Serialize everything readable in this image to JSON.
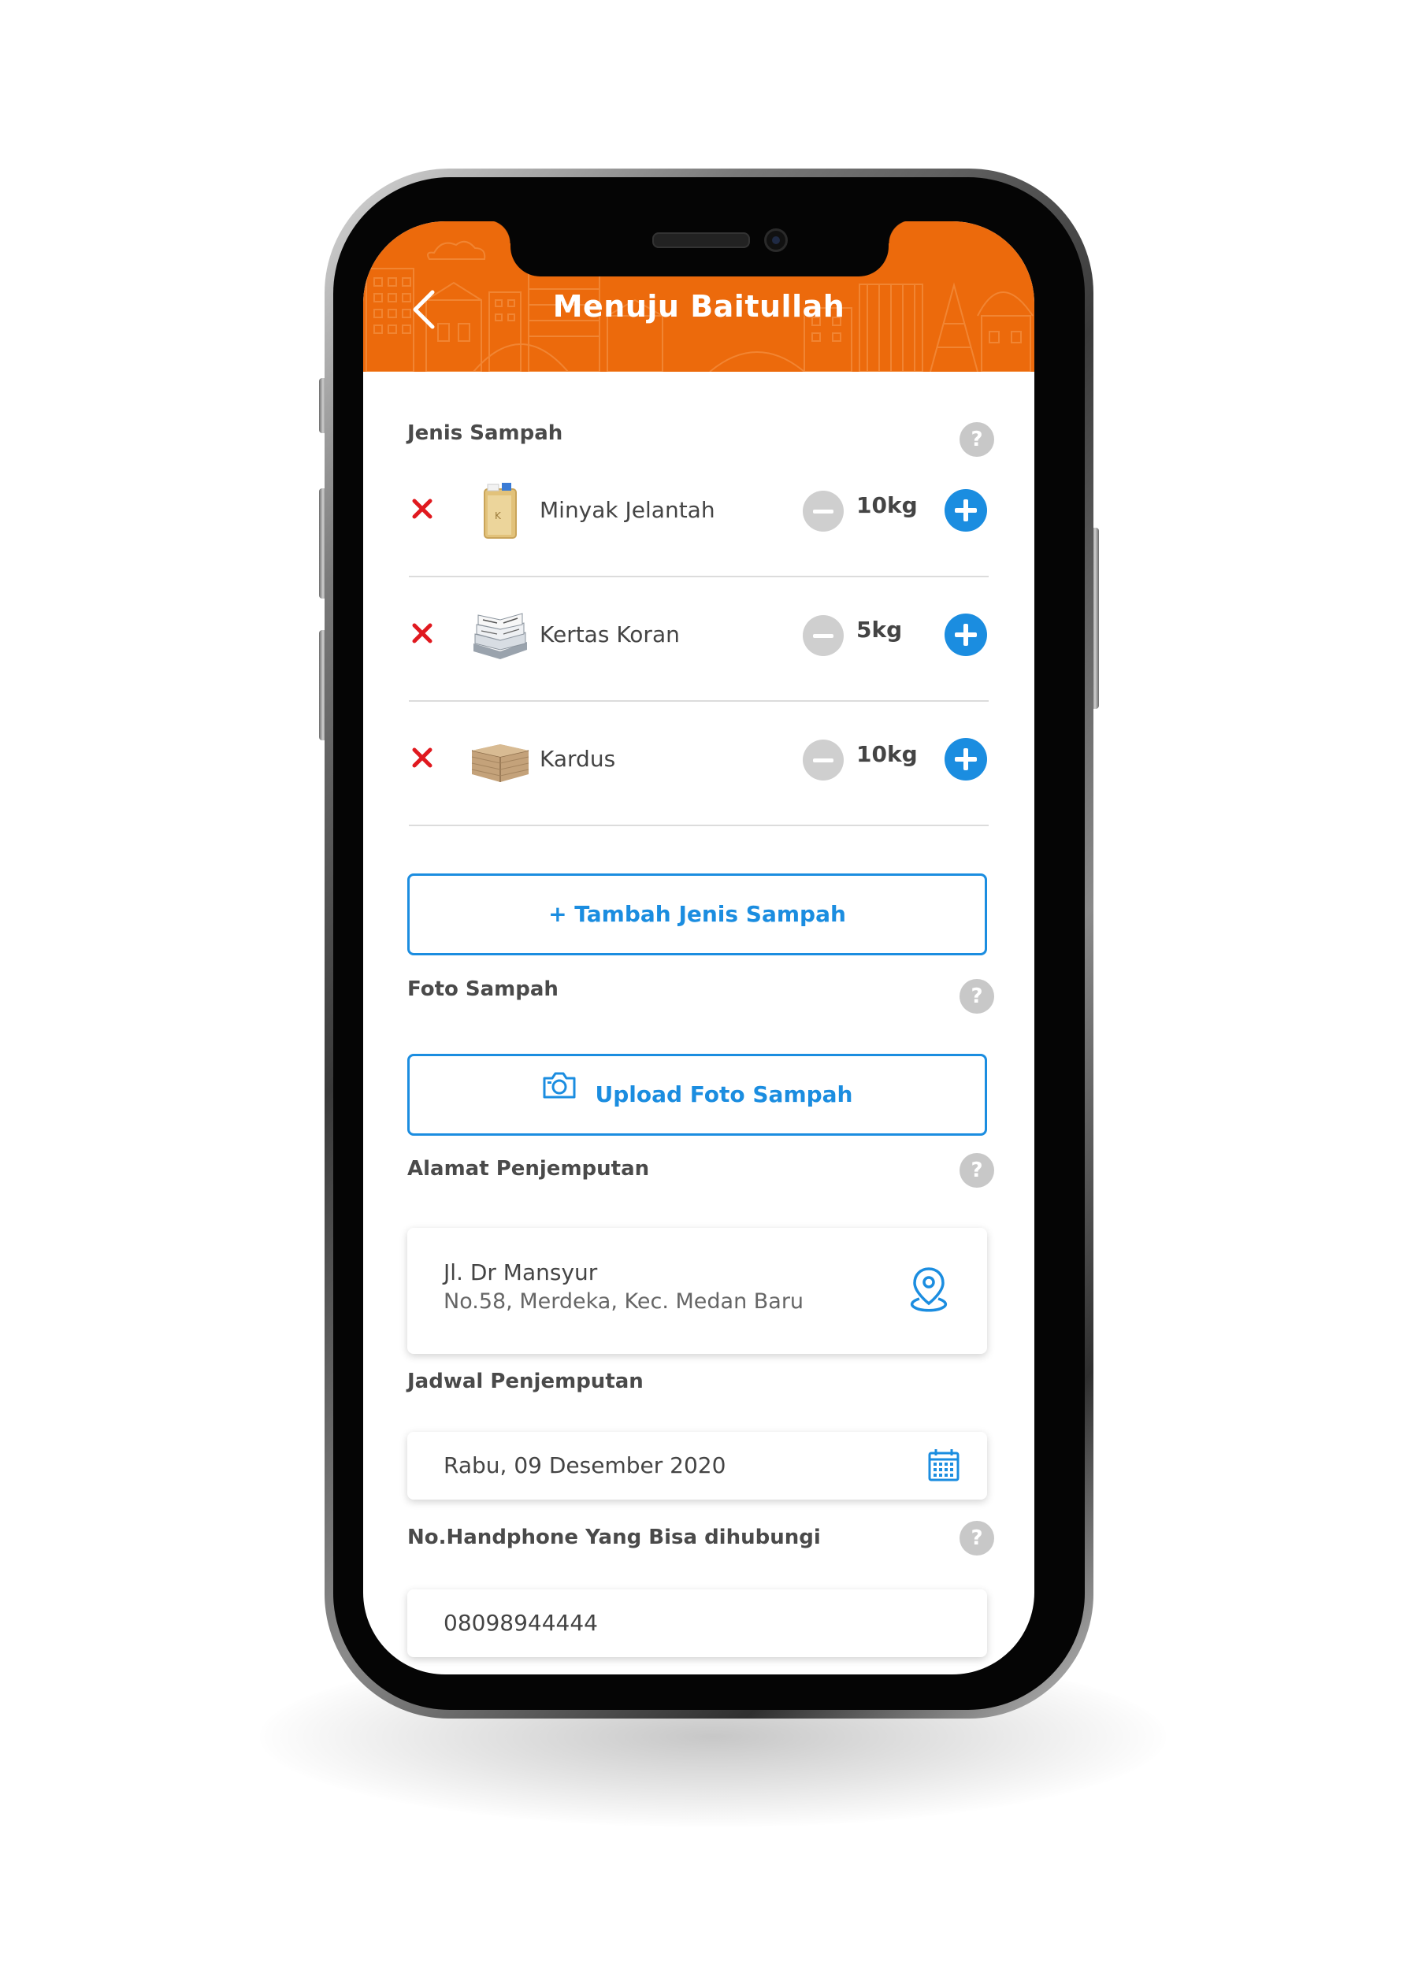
{
  "header": {
    "title": "Menuju Baitullah",
    "back_icon": "back-arrow-icon",
    "background_color": "#ec6a0c"
  },
  "jenis_sampah": {
    "label": "Jenis Sampah",
    "help": "?",
    "items": [
      {
        "name": "Minyak Jelantah",
        "qty": "10kg",
        "icon": "cooking-oil-jerrycan-icon"
      },
      {
        "name": "Kertas Koran",
        "qty": "5kg",
        "icon": "newspaper-stack-icon"
      },
      {
        "name": "Kardus",
        "qty": "10kg",
        "icon": "cardboard-stack-icon"
      }
    ],
    "add_button": "+ Tambah Jenis Sampah"
  },
  "foto_sampah": {
    "label": "Foto Sampah",
    "help": "?",
    "upload_button": "Upload Foto Sampah",
    "upload_icon": "camera-icon"
  },
  "alamat": {
    "label": "Alamat Penjemputan",
    "help": "?",
    "line1": "Jl. Dr Mansyur",
    "line2": "No.58, Merdeka, Kec. Medan Baru",
    "icon": "location-pin-icon"
  },
  "jadwal": {
    "label": "Jadwal Penjemputan",
    "value": "Rabu, 09 Desember 2020",
    "icon": "calendar-icon"
  },
  "phone": {
    "label": "No.Handphone Yang Bisa dihubungi",
    "help": "?",
    "value": "08098944444"
  },
  "colors": {
    "accent_blue": "#1b8de0",
    "delete_red": "#e0191f",
    "minus_gray": "#cfcfcf"
  }
}
